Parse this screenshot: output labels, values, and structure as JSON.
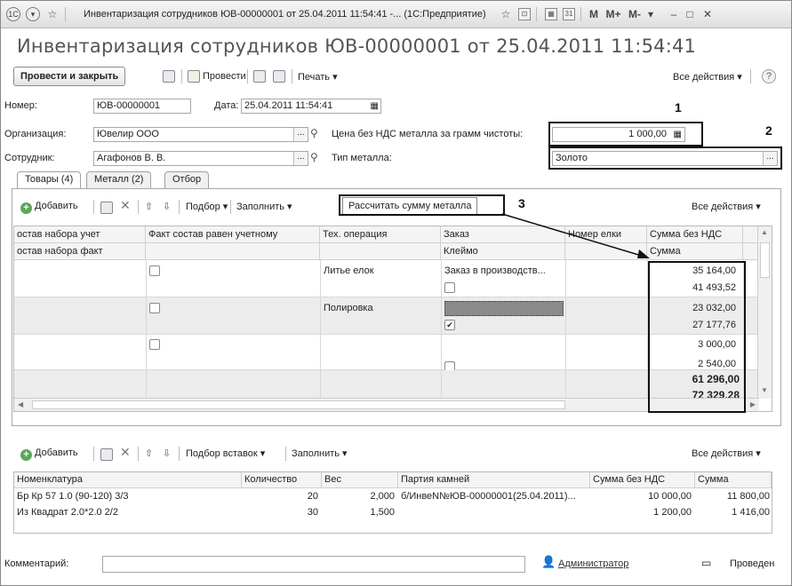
{
  "titlebar": {
    "text": "Инвентаризация сотрудников ЮВ-00000001 от 25.04.2011 11:54:41 -...  (1С:Предприятие)",
    "m_labels": [
      "M",
      "M+",
      "M-"
    ]
  },
  "doc_title": "Инвентаризация сотрудников ЮВ-00000001 от 25.04.2011 11:54:41",
  "toolbar": {
    "post_close": "Провести и закрыть",
    "post": "Провести",
    "print": "Печать ▾",
    "all_actions": "Все действия ▾",
    "help": "?"
  },
  "form": {
    "number_label": "Номер:",
    "number_value": "ЮВ-00000001",
    "date_label": "Дата:",
    "date_value": "25.04.2011 11:54:41",
    "org_label": "Организация:",
    "org_value": "Ювелир ООО",
    "price_label": "Цена без НДС металла за грамм чистоты:",
    "price_value": "1 000,00",
    "employee_label": "Сотрудник:",
    "employee_value": "Агафонов В. В.",
    "metal_label": "Тип металла:",
    "metal_value": "Золото",
    "dots": "...",
    "mag": "🔍"
  },
  "callouts": [
    "1",
    "2",
    "3"
  ],
  "tabs": [
    "Товары (4)",
    "Металл (2)",
    "Отбор"
  ],
  "grid_toolbar": {
    "add": "Добавить",
    "pick": "Подбор ▾",
    "fill": "Заполнить ▾",
    "calc": "Рассчитать сумму металла",
    "all_actions": "Все действия ▾"
  },
  "grid": {
    "headers_top": [
      "остав набора учет",
      "Факт состав равен учетному",
      "Тех. операция",
      "Заказ",
      "Номер елки",
      "Сумма без НДС"
    ],
    "headers_bottom": [
      "остав набора факт",
      "",
      "",
      "Клеймо",
      "",
      "Сумма"
    ],
    "rows": [
      {
        "op": "Литье елок",
        "order": "Заказ в производств...",
        "sum1": "35 164,00",
        "sum2": "41 493,52",
        "checked": false,
        "stamp_checked": false
      },
      {
        "op": "Полировка",
        "order": "",
        "sum1": "23 032,00",
        "sum2": "27 177,76",
        "checked": false,
        "stamp_checked": true
      },
      {
        "op": "",
        "order": "",
        "sum1": "3 000,00",
        "sum2": "2 540,00",
        "checked": false,
        "stamp_checked": false
      }
    ],
    "total1": "61 296,00",
    "total2": "72 329,28"
  },
  "grid2_toolbar": {
    "add": "Добавить",
    "pick": "Подбор вставок ▾",
    "fill": "Заполнить ▾",
    "all_actions": "Все действия ▾"
  },
  "grid2": {
    "headers": [
      "Номенклатура",
      "Количество",
      "Вес",
      "Партия камней",
      "Сумма без НДС",
      "Сумма"
    ],
    "rows": [
      [
        "Бр Кр 57 1.0 (90-120) 3/3",
        "20",
        "2,000",
        "б/ИнвеN№ЮВ-00000001(25.04.2011)...",
        "10 000,00",
        "11 800,00"
      ],
      [
        "Из Квадрат 2.0*2.0 2/2",
        "30",
        "1,500",
        "",
        "1 200,00",
        "1 416,00"
      ]
    ]
  },
  "footer": {
    "comment_label": "Комментарий:",
    "user": "Администратор",
    "status": "Проведен"
  }
}
